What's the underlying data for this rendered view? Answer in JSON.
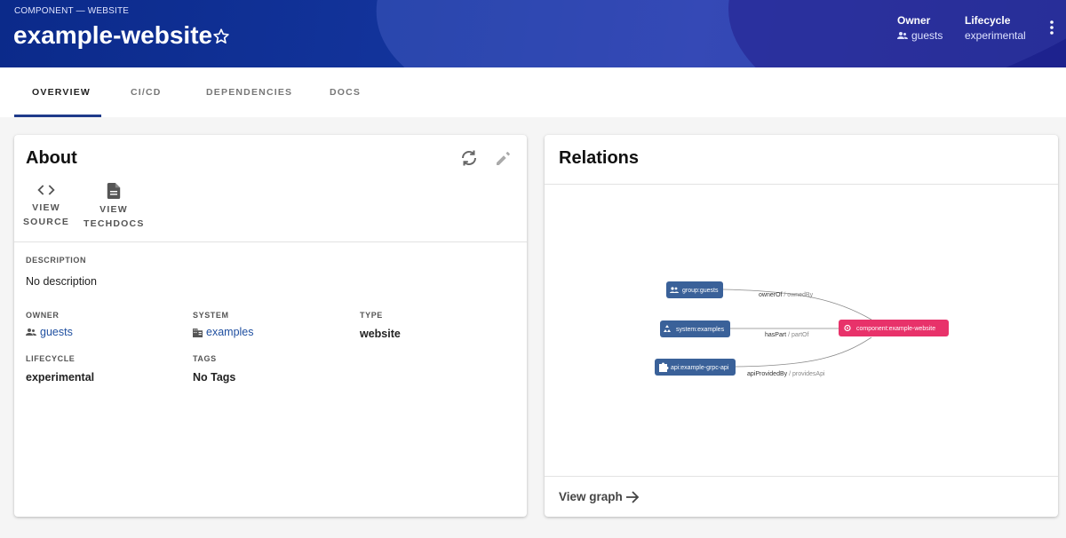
{
  "header": {
    "breadcrumb": "COMPONENT — WEBSITE",
    "title": "example-website",
    "owner_label": "Owner",
    "owner_value": "guests",
    "lifecycle_label": "Lifecycle",
    "lifecycle_value": "experimental"
  },
  "tabs": [
    {
      "label": "OVERVIEW",
      "active": true
    },
    {
      "label": "CI/CD"
    },
    {
      "label": "DEPENDENCIES"
    },
    {
      "label": "DOCS"
    }
  ],
  "about": {
    "title": "About",
    "links": {
      "view_source": [
        "VIEW",
        "SOURCE"
      ],
      "view_techdocs": [
        "VIEW",
        "TECHDOCS"
      ]
    },
    "description_label": "DESCRIPTION",
    "description_value": "No description",
    "owner_label": "OWNER",
    "owner_value": "guests",
    "system_label": "SYSTEM",
    "system_value": "examples",
    "type_label": "TYPE",
    "type_value": "website",
    "lifecycle_label": "LIFECYCLE",
    "lifecycle_value": "experimental",
    "tags_label": "TAGS",
    "tags_value": "No Tags"
  },
  "relations": {
    "title": "Relations",
    "view_graph": "View graph",
    "nodes": {
      "group": "group:guests",
      "system": "system:examples",
      "api": "api:example-grpc-api",
      "component": "component:example-website"
    },
    "edges": [
      {
        "primary": "ownerOf",
        "secondary": " / ownedBy"
      },
      {
        "primary": "hasPart",
        "secondary": " / partOf"
      },
      {
        "primary": "apiProvidedBy",
        "secondary": " / providesApi"
      }
    ]
  },
  "colors": {
    "header": "#13349c",
    "node": "#3a6199",
    "focus_node": "#e8326a",
    "link": "#1f4fa0"
  }
}
